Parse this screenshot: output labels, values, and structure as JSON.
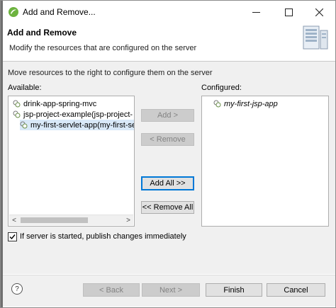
{
  "window": {
    "title": "Add and Remove...",
    "minimize_icon": "minimize-icon",
    "maximize_icon": "maximize-icon",
    "close_icon": "close-icon"
  },
  "header": {
    "title": "Add and Remove",
    "description": "Modify the resources that are configured on the server",
    "banner_icon": "server-banner-icon"
  },
  "instruction": "Move resources to the right to configure them on the server",
  "available": {
    "label": "Available:",
    "items": [
      {
        "label": "drink-app-spring-mvc",
        "selected": false
      },
      {
        "label": "jsp-project-example(jsp-project-",
        "selected": false
      },
      {
        "label": "my-first-servlet-app(my-first-serv",
        "selected": true
      }
    ],
    "scroll_left": "<",
    "scroll_right": ">"
  },
  "configured": {
    "label": "Configured:",
    "items": [
      {
        "label": "my-first-jsp-app"
      }
    ]
  },
  "buttons": {
    "add": "Add >",
    "remove": "< Remove",
    "add_all": "Add All >>",
    "remove_all": "<< Remove All"
  },
  "publish_checkbox": {
    "label": "If server is started, publish changes immediately",
    "checked": true
  },
  "footer": {
    "help": "?",
    "back": "< Back",
    "next": "Next >",
    "finish": "Finish",
    "cancel": "Cancel"
  },
  "colors": {
    "default_button_border": "#0078d7",
    "selection": "#d9e9f8",
    "dialog_bg": "#f0f0f0"
  }
}
